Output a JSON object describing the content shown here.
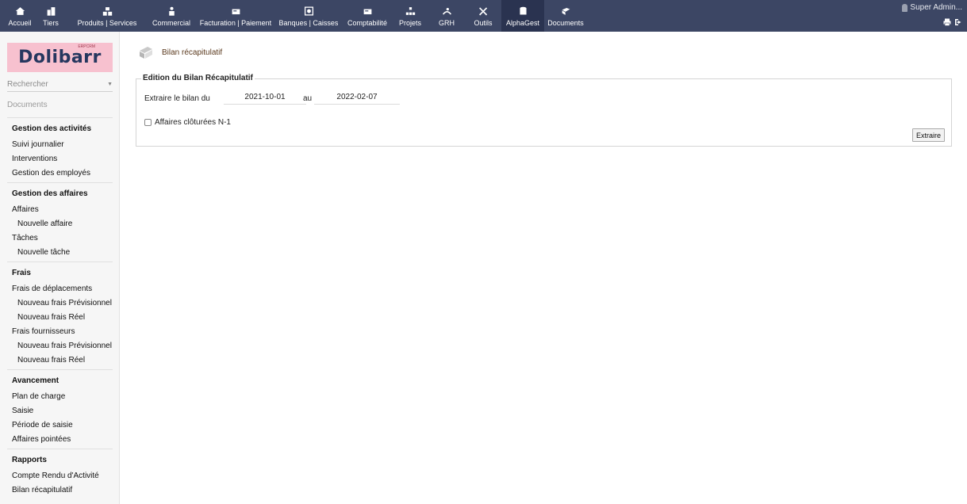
{
  "topbar": {
    "menu": [
      {
        "label": "Accueil",
        "icon": "home-icon"
      },
      {
        "label": "Tiers",
        "icon": "building-icon"
      },
      {
        "label": "Produits | Services",
        "icon": "cubes-icon"
      },
      {
        "label": "Commercial",
        "icon": "suitcase-person-icon"
      },
      {
        "label": "Facturation | Paiement",
        "icon": "invoice-icon"
      },
      {
        "label": "Banques | Caisses",
        "icon": "bank-icon"
      },
      {
        "label": "Comptabilité",
        "icon": "ledger-icon"
      },
      {
        "label": "Projets",
        "icon": "sitemap-icon"
      },
      {
        "label": "GRH",
        "icon": "people-icon"
      },
      {
        "label": "Outils",
        "icon": "tools-icon"
      },
      {
        "label": "AlphaGest",
        "icon": "database-icon"
      },
      {
        "label": "Documents",
        "icon": "folder-icon"
      }
    ],
    "active_label": "AlphaGest",
    "user_name": "Super Admin..."
  },
  "sidebar": {
    "logo": "Dolibarr",
    "logo_tag": "ERPCRM",
    "search_placeholder": "Rechercher",
    "module": "Documents",
    "sections": [
      {
        "title": "Gestion des activités",
        "links": [
          "Suivi journalier",
          "Interventions",
          "Gestion des employés"
        ]
      },
      {
        "title": "Gestion des affaires",
        "links": [
          "Affaires",
          "Nouvelle affaire",
          "Tâches",
          "Nouvelle tâche"
        ]
      },
      {
        "title": "Frais",
        "links": [
          "Frais de déplacements",
          "Nouveau frais Prévisionnel",
          "Nouveau frais Réel",
          "Frais fournisseurs",
          "Nouveau frais Prévisionnel",
          "Nouveau frais Réel"
        ]
      },
      {
        "title": "Avancement",
        "links": [
          "Plan de charge",
          "Saisie",
          "Période de saisie",
          "Affaires pointées"
        ]
      },
      {
        "title": "Rapports",
        "links": [
          "Compte Rendu d'Activité",
          "Bilan récapitulatif"
        ]
      }
    ]
  },
  "main": {
    "page_title": "Bilan récapitulatif",
    "form": {
      "legend": "Edition du Bilan Récapitulatif",
      "extract_label": "Extraire le bilan du",
      "date_from": "2021-10-01",
      "au_label": "au",
      "date_to": "2022-02-07",
      "checkbox_label": "Affaires clôturées N-1",
      "checkbox_checked": false,
      "submit_label": "Extraire"
    }
  },
  "colors": {
    "topbar_bg": "#3c4664",
    "logo_bg": "#f7c1cf",
    "logo_text": "#26375f",
    "title_color": "#5b3a1e"
  }
}
